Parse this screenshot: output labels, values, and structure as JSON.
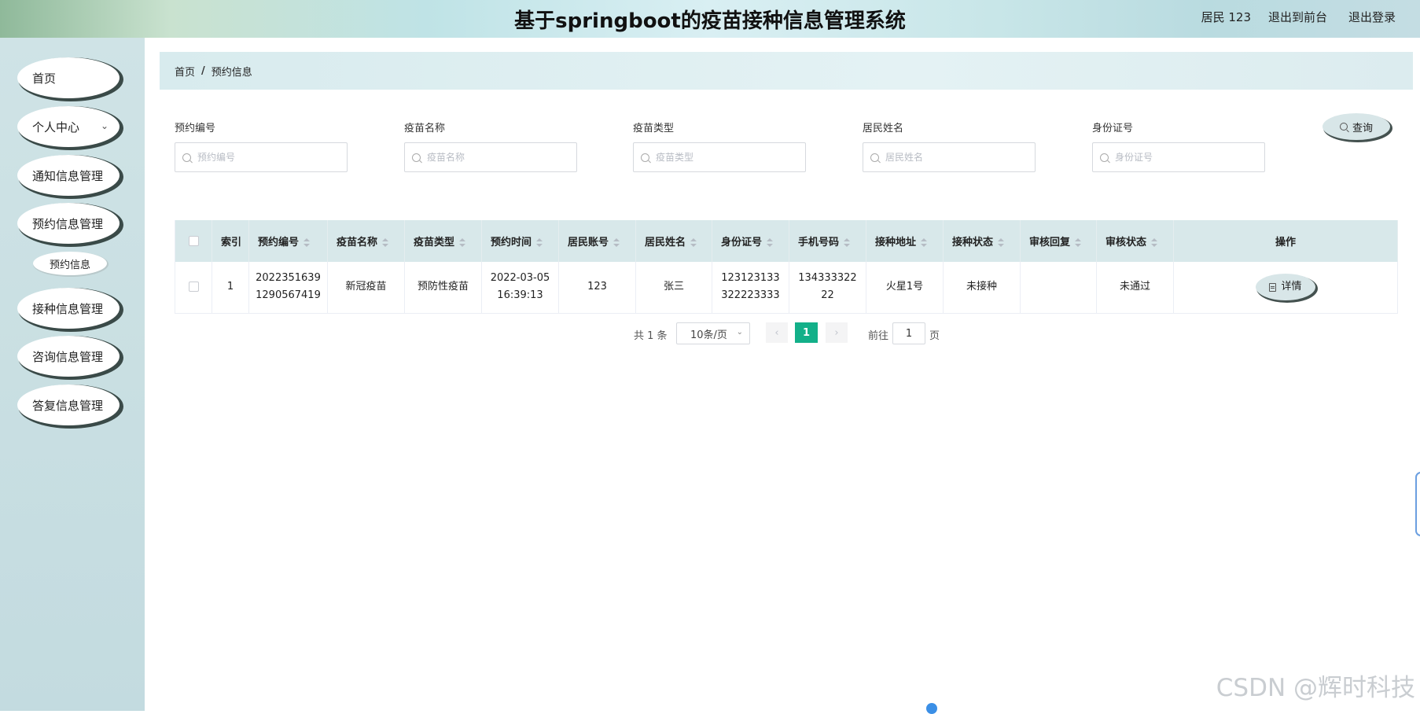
{
  "header": {
    "title": "基于springboot的疫苗接种信息管理系统",
    "user": "居民 123",
    "front_link": "退出到前台",
    "logout_link": "退出登录"
  },
  "sidebar": {
    "items": [
      {
        "label": "首页"
      },
      {
        "label": "个人中心"
      },
      {
        "label": "通知信息管理"
      },
      {
        "label": "预约信息管理"
      },
      {
        "label": "接种信息管理"
      },
      {
        "label": "咨询信息管理"
      },
      {
        "label": "答复信息管理"
      }
    ],
    "sub_item": "预约信息"
  },
  "breadcrumb": {
    "home": "首页",
    "sep": "/",
    "current": "预约信息"
  },
  "search": {
    "fields": [
      {
        "label": "预约编号",
        "placeholder": "预约编号",
        "value": ""
      },
      {
        "label": "疫苗名称",
        "placeholder": "疫苗名称",
        "value": ""
      },
      {
        "label": "疫苗类型",
        "placeholder": "疫苗类型",
        "value": ""
      },
      {
        "label": "居民姓名",
        "placeholder": "居民姓名",
        "value": ""
      },
      {
        "label": "身份证号",
        "placeholder": "身份证号",
        "value": ""
      }
    ],
    "query_button": "查询"
  },
  "table": {
    "columns": [
      "索引",
      "预约编号",
      "疫苗名称",
      "疫苗类型",
      "预约时间",
      "居民账号",
      "居民姓名",
      "身份证号",
      "手机号码",
      "接种地址",
      "接种状态",
      "审核回复",
      "审核状态",
      "操作"
    ],
    "rows": [
      {
        "index": "1",
        "order_no_1": "2022351639",
        "order_no_2": "1290567419",
        "vaccine_name": "新冠疫苗",
        "vaccine_type": "预防性疫苗",
        "time_1": "2022-03-05",
        "time_2": "16:39:13",
        "account": "123",
        "name": "张三",
        "id_1": "123123133",
        "id_2": "322223333",
        "phone_1": "134333322",
        "phone_2": "22",
        "address": "火星1号",
        "vacc_status": "未接种",
        "review_reply": "",
        "review_status": "未通过",
        "action": "详情"
      }
    ]
  },
  "pagination": {
    "total": "共 1 条",
    "page_size": "10条/页",
    "current_page": "1",
    "goto_label": "前往",
    "goto_value": "1",
    "page_suffix": "页",
    "prev": "‹",
    "next": "›"
  },
  "watermark": "CSDN @辉时科技",
  "colors": {
    "accent": "#13b089",
    "table_header": "#d8e8ea",
    "sidebar": "#cfe3e6"
  }
}
